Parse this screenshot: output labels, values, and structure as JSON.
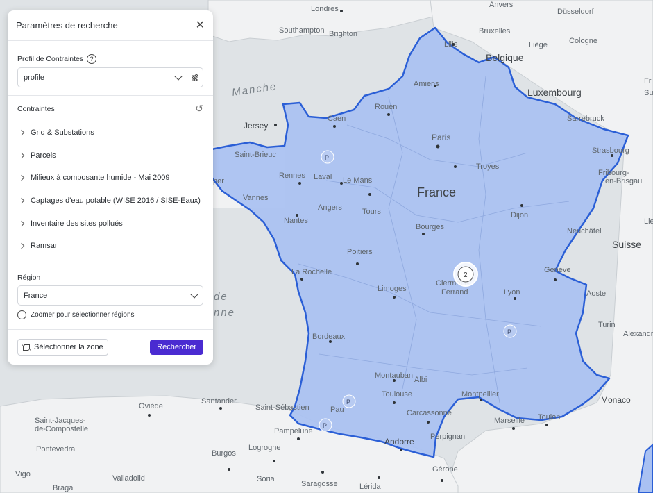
{
  "panel": {
    "title": "Paramètres de recherche",
    "profile": {
      "label": "Profil de Contraintes",
      "value": "profile"
    },
    "constraints": {
      "title": "Contraintes",
      "items": [
        {
          "label": "Grid & Substations"
        },
        {
          "label": "Parcels"
        },
        {
          "label": "Milieux à composante humide - Mai 2009"
        },
        {
          "label": "Captages d'eau potable (WISE 2016 / SISE-Eaux)"
        },
        {
          "label": "Inventaire des sites pollués"
        },
        {
          "label": "Ramsar"
        }
      ]
    },
    "region": {
      "label": "Région",
      "value": "France",
      "hint": "Zoomer pour sélectionner régions"
    },
    "buttons": {
      "select_zone": "Sélectionner la zone",
      "search": "Rechercher"
    }
  },
  "map": {
    "colors": {
      "land": "#f1f2f3",
      "water": "#dfe3e6",
      "highlight_fill": "#a9c1f2",
      "highlight_border": "#2b5fd6",
      "accent": "#4a2bd1"
    },
    "cluster_count": "2",
    "labels": {
      "london": "Londres",
      "southampton": "Southampton",
      "brighton": "Brighton",
      "bruxelles": "Bruxelles",
      "lille": "Lille",
      "liege": "Liège",
      "belgique": "Belgique",
      "anvers": "Anvers",
      "dusseldorf": "Düsseldorf",
      "cologne": "Cologne",
      "luxembourg": "Luxembourg",
      "fr": "Fr",
      "sui": "Su",
      "manche": "Manche",
      "jersey": "Jersey",
      "amiens": "Amiens",
      "rouen": "Rouen",
      "caen": "Caen",
      "paris": "Paris",
      "sarrebruck": "Sarrebruck",
      "strasbourg": "Strasbourg",
      "fribourg": "Fribourg-",
      "brisgau": "en-Brisgau",
      "saint_brieuc": "Saint-Brieuc",
      "rennes": "Rennes",
      "laval": "Laval",
      "le_mans": "Le Mans",
      "troyes": "Troyes",
      "france": "France",
      "vannes": "Vannes",
      "angers": "Angers",
      "tours": "Tours",
      "dijon": "Dijon",
      "nantes": "Nantes",
      "bourges": "Bourges",
      "neuchatel": "Neuchâtel",
      "suisse": "Suisse",
      "poitiers": "Poitiers",
      "la_rochelle": "La Rochelle",
      "geneve": "Genève",
      "limoges": "Limoges",
      "clermont": "Clermont-",
      "ferrand": "Ferrand",
      "lyon": "Lyon",
      "aoste": "Aoste",
      "turin": "Turin",
      "alexandrie": "Alexandrie",
      "bordeaux": "Bordeaux",
      "montauban": "Montauban",
      "albi": "Albi",
      "toulouse": "Toulouse",
      "montpellier": "Montpellier",
      "monaco": "Monaco",
      "oviede": "Oviède",
      "santander": "Santander",
      "saint_sebastien": "Saint-Sébastien",
      "pau": "Pau",
      "carcassonne": "Carcassonne",
      "marseille": "Marseille",
      "toulon": "Toulon",
      "santiago1": "Saint-Jacques-",
      "santiago2": "de-Compostelle",
      "pampelune": "Pampelune",
      "andorre": "Andorre",
      "perpignan": "Perpignan",
      "pontevedra": "Pontevedra",
      "burgos": "Burgos",
      "logrogne": "Logrogne",
      "gerone": "Gérone",
      "valladolid": "Valladolid",
      "soria": "Soria",
      "braga": "Braga",
      "saragosse": "Saragosse",
      "lerida": "Lérida",
      "vigo": "Vigo",
      "de": "de",
      "nne": "nne",
      "lie": "Lie",
      "per": "per"
    }
  }
}
